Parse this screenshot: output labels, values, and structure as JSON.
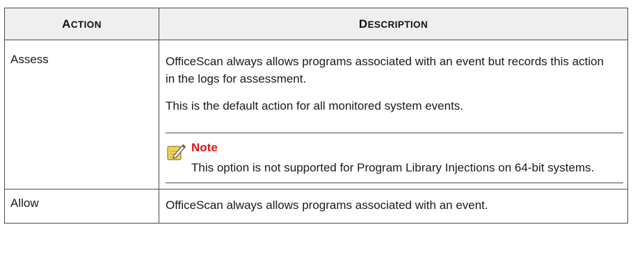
{
  "table": {
    "headers": {
      "action": {
        "first": "A",
        "rest": "CTION"
      },
      "description": {
        "first": "D",
        "rest": "ESCRIPTION"
      }
    },
    "rows": [
      {
        "action": "Assess",
        "paragraphs": [
          "OfficeScan always allows programs associated with an event but records this action in the logs for assessment.",
          "This is the default action for all monitored system events."
        ],
        "note": {
          "icon": "note-pencil-icon",
          "title": "Note",
          "text": "This option is not supported for Program Library Injections on 64-bit systems."
        }
      },
      {
        "action": "Allow",
        "paragraphs": [
          "OfficeScan always allows programs associated with an event."
        ]
      }
    ]
  },
  "colors": {
    "header_bg": "#efefef",
    "border": "#4a4a4a",
    "note_title": "#e3121b",
    "note_icon_fill": "#f3d25a"
  }
}
